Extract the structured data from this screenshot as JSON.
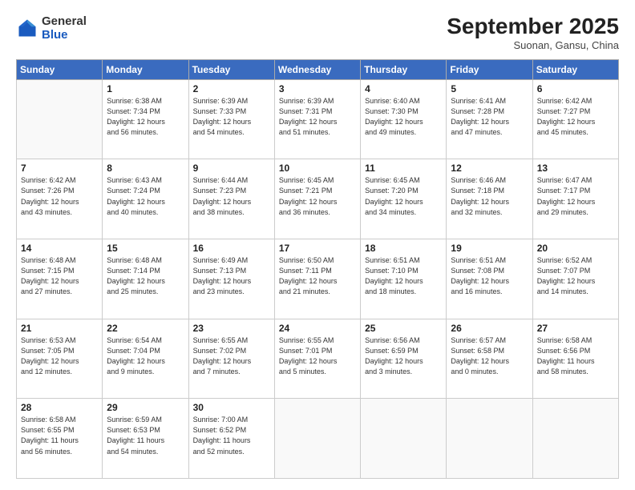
{
  "logo": {
    "general": "General",
    "blue": "Blue"
  },
  "header": {
    "month": "September 2025",
    "location": "Suonan, Gansu, China"
  },
  "weekdays": [
    "Sunday",
    "Monday",
    "Tuesday",
    "Wednesday",
    "Thursday",
    "Friday",
    "Saturday"
  ],
  "weeks": [
    [
      {
        "num": "",
        "info": ""
      },
      {
        "num": "1",
        "info": "Sunrise: 6:38 AM\nSunset: 7:34 PM\nDaylight: 12 hours\nand 56 minutes."
      },
      {
        "num": "2",
        "info": "Sunrise: 6:39 AM\nSunset: 7:33 PM\nDaylight: 12 hours\nand 54 minutes."
      },
      {
        "num": "3",
        "info": "Sunrise: 6:39 AM\nSunset: 7:31 PM\nDaylight: 12 hours\nand 51 minutes."
      },
      {
        "num": "4",
        "info": "Sunrise: 6:40 AM\nSunset: 7:30 PM\nDaylight: 12 hours\nand 49 minutes."
      },
      {
        "num": "5",
        "info": "Sunrise: 6:41 AM\nSunset: 7:28 PM\nDaylight: 12 hours\nand 47 minutes."
      },
      {
        "num": "6",
        "info": "Sunrise: 6:42 AM\nSunset: 7:27 PM\nDaylight: 12 hours\nand 45 minutes."
      }
    ],
    [
      {
        "num": "7",
        "info": "Sunrise: 6:42 AM\nSunset: 7:26 PM\nDaylight: 12 hours\nand 43 minutes."
      },
      {
        "num": "8",
        "info": "Sunrise: 6:43 AM\nSunset: 7:24 PM\nDaylight: 12 hours\nand 40 minutes."
      },
      {
        "num": "9",
        "info": "Sunrise: 6:44 AM\nSunset: 7:23 PM\nDaylight: 12 hours\nand 38 minutes."
      },
      {
        "num": "10",
        "info": "Sunrise: 6:45 AM\nSunset: 7:21 PM\nDaylight: 12 hours\nand 36 minutes."
      },
      {
        "num": "11",
        "info": "Sunrise: 6:45 AM\nSunset: 7:20 PM\nDaylight: 12 hours\nand 34 minutes."
      },
      {
        "num": "12",
        "info": "Sunrise: 6:46 AM\nSunset: 7:18 PM\nDaylight: 12 hours\nand 32 minutes."
      },
      {
        "num": "13",
        "info": "Sunrise: 6:47 AM\nSunset: 7:17 PM\nDaylight: 12 hours\nand 29 minutes."
      }
    ],
    [
      {
        "num": "14",
        "info": "Sunrise: 6:48 AM\nSunset: 7:15 PM\nDaylight: 12 hours\nand 27 minutes."
      },
      {
        "num": "15",
        "info": "Sunrise: 6:48 AM\nSunset: 7:14 PM\nDaylight: 12 hours\nand 25 minutes."
      },
      {
        "num": "16",
        "info": "Sunrise: 6:49 AM\nSunset: 7:13 PM\nDaylight: 12 hours\nand 23 minutes."
      },
      {
        "num": "17",
        "info": "Sunrise: 6:50 AM\nSunset: 7:11 PM\nDaylight: 12 hours\nand 21 minutes."
      },
      {
        "num": "18",
        "info": "Sunrise: 6:51 AM\nSunset: 7:10 PM\nDaylight: 12 hours\nand 18 minutes."
      },
      {
        "num": "19",
        "info": "Sunrise: 6:51 AM\nSunset: 7:08 PM\nDaylight: 12 hours\nand 16 minutes."
      },
      {
        "num": "20",
        "info": "Sunrise: 6:52 AM\nSunset: 7:07 PM\nDaylight: 12 hours\nand 14 minutes."
      }
    ],
    [
      {
        "num": "21",
        "info": "Sunrise: 6:53 AM\nSunset: 7:05 PM\nDaylight: 12 hours\nand 12 minutes."
      },
      {
        "num": "22",
        "info": "Sunrise: 6:54 AM\nSunset: 7:04 PM\nDaylight: 12 hours\nand 9 minutes."
      },
      {
        "num": "23",
        "info": "Sunrise: 6:55 AM\nSunset: 7:02 PM\nDaylight: 12 hours\nand 7 minutes."
      },
      {
        "num": "24",
        "info": "Sunrise: 6:55 AM\nSunset: 7:01 PM\nDaylight: 12 hours\nand 5 minutes."
      },
      {
        "num": "25",
        "info": "Sunrise: 6:56 AM\nSunset: 6:59 PM\nDaylight: 12 hours\nand 3 minutes."
      },
      {
        "num": "26",
        "info": "Sunrise: 6:57 AM\nSunset: 6:58 PM\nDaylight: 12 hours\nand 0 minutes."
      },
      {
        "num": "27",
        "info": "Sunrise: 6:58 AM\nSunset: 6:56 PM\nDaylight: 11 hours\nand 58 minutes."
      }
    ],
    [
      {
        "num": "28",
        "info": "Sunrise: 6:58 AM\nSunset: 6:55 PM\nDaylight: 11 hours\nand 56 minutes."
      },
      {
        "num": "29",
        "info": "Sunrise: 6:59 AM\nSunset: 6:53 PM\nDaylight: 11 hours\nand 54 minutes."
      },
      {
        "num": "30",
        "info": "Sunrise: 7:00 AM\nSunset: 6:52 PM\nDaylight: 11 hours\nand 52 minutes."
      },
      {
        "num": "",
        "info": ""
      },
      {
        "num": "",
        "info": ""
      },
      {
        "num": "",
        "info": ""
      },
      {
        "num": "",
        "info": ""
      }
    ]
  ]
}
